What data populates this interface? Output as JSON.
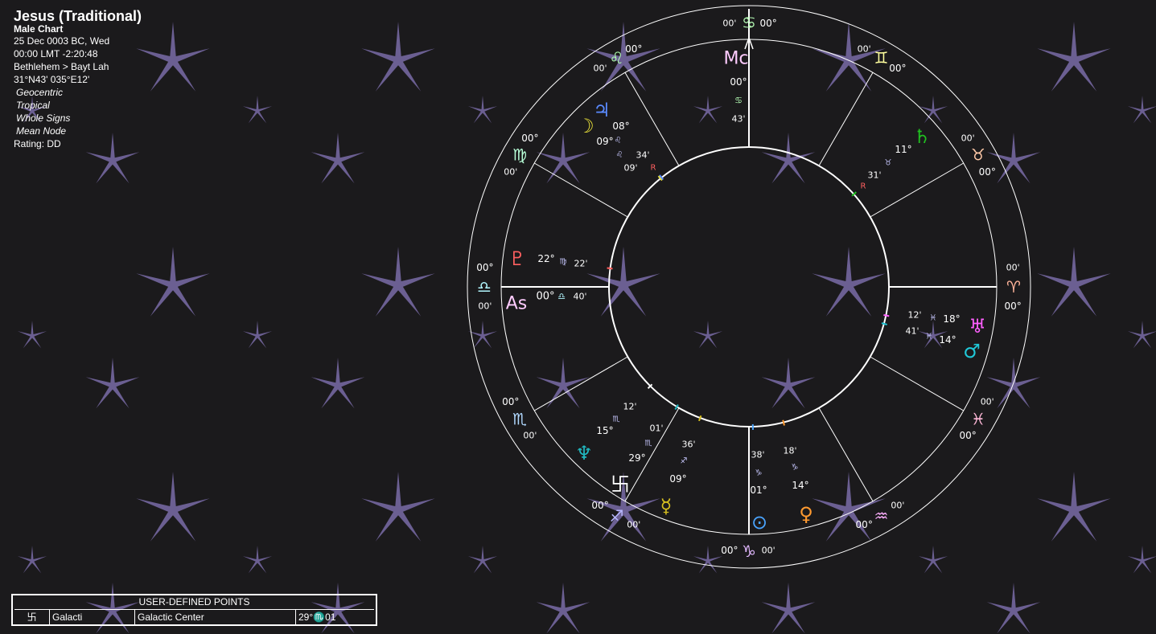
{
  "info": {
    "title": "Jesus (Traditional)",
    "subtitle": "Male Chart",
    "date": "25 Dec 0003 BC, Wed",
    "time": "00:00  LMT -2:20:48",
    "place": "Bethlehem > Bayt Lah",
    "coords": "31°N43' 035°E12'",
    "zodiac_type": "Geocentric",
    "zodiac": "Tropical",
    "houses": "Whole Signs",
    "node": "Mean Node",
    "rating": "Rating: DD"
  },
  "udp": {
    "header": "USER-DEFINED POINTS",
    "rows": [
      {
        "glyph": "卐",
        "name": "Galacti",
        "full": "Galactic Center",
        "pos": "29°♏01"
      }
    ]
  },
  "colors": {
    "background": "#1b1a1c",
    "star": "#6b5f92",
    "wheel": "#ffffff"
  },
  "signs": [
    {
      "name": "Aries",
      "glyph": "♈",
      "color": "#ffb49a",
      "deg": "00°",
      "min": "00'"
    },
    {
      "name": "Taurus",
      "glyph": "♉",
      "color": "#ffc9a8",
      "deg": "00°",
      "min": "00'"
    },
    {
      "name": "Gemini",
      "glyph": "♊",
      "color": "#ffff9e",
      "deg": "00°",
      "min": "00'"
    },
    {
      "name": "Cancer",
      "glyph": "♋",
      "color": "#b6ffb6",
      "deg": "00°",
      "min": "00'"
    },
    {
      "name": "Leo",
      "glyph": "♌",
      "color": "#b0ffb0",
      "deg": "00°",
      "min": "00'"
    },
    {
      "name": "Virgo",
      "glyph": "♍",
      "color": "#b8ffd8",
      "deg": "00°",
      "min": "00'"
    },
    {
      "name": "Libra",
      "glyph": "♎",
      "color": "#b2f7ff",
      "deg": "00°",
      "min": "00'"
    },
    {
      "name": "Scorpio",
      "glyph": "♏",
      "color": "#b0d8ff",
      "deg": "00°",
      "min": "00'"
    },
    {
      "name": "Sagittarius",
      "glyph": "♐",
      "color": "#b8b8ff",
      "deg": "00°",
      "min": "00'"
    },
    {
      "name": "Capricorn",
      "glyph": "♑",
      "color": "#e2b8ff",
      "deg": "00°",
      "min": "00'"
    },
    {
      "name": "Aquarius",
      "glyph": "♒",
      "color": "#ffb0ff",
      "deg": "00°",
      "min": "00'"
    },
    {
      "name": "Pisces",
      "glyph": "♓",
      "color": "#ffb8d8",
      "deg": "00°",
      "min": "00'"
    }
  ],
  "angles": {
    "asc": {
      "label": "As",
      "deg": "00°",
      "sign": "♎",
      "min": "40'",
      "color": "#ffccff"
    },
    "mc": {
      "label": "Mc",
      "deg": "00°",
      "sign": "♋",
      "min": "43'",
      "color": "#ffccff"
    }
  },
  "planets": [
    {
      "name": "Sun",
      "glyph": "⊙",
      "color": "#4aa4ff",
      "deg": "01°",
      "sign": "♑",
      "min": "38'",
      "retro": ""
    },
    {
      "name": "Moon",
      "glyph": "☽",
      "color": "#e8e03a",
      "deg": "09°",
      "sign": "♌",
      "min": "09'",
      "retro": ""
    },
    {
      "name": "Mercury",
      "glyph": "☿",
      "color": "#d8c020",
      "deg": "09°",
      "sign": "♐",
      "min": "36'",
      "retro": ""
    },
    {
      "name": "Venus",
      "glyph": "♀",
      "color": "#ff9a30",
      "deg": "14°",
      "sign": "♑",
      "min": "18'",
      "retro": ""
    },
    {
      "name": "Mars",
      "glyph": "♂",
      "color": "#20c8d8",
      "deg": "14°",
      "sign": "♓",
      "min": "41'",
      "retro": ""
    },
    {
      "name": "Jupiter",
      "glyph": "♃",
      "color": "#5a8aff",
      "deg": "08°",
      "sign": "♌",
      "min": "34'",
      "retro": "R"
    },
    {
      "name": "Saturn",
      "glyph": "♄",
      "color": "#20c020",
      "deg": "11°",
      "sign": "♉",
      "min": "31'",
      "retro": "R"
    },
    {
      "name": "Uranus",
      "glyph": "♅",
      "color": "#ff60ff",
      "deg": "18°",
      "sign": "♓",
      "min": "12'",
      "retro": ""
    },
    {
      "name": "Neptune",
      "glyph": "♆",
      "color": "#20b8c0",
      "deg": "29°",
      "sign": "♏",
      "min": "01'",
      "retro": ""
    },
    {
      "name": "Pluto",
      "glyph": "♇",
      "color": "#ff6060",
      "deg": "22°",
      "sign": "♍",
      "min": "22'",
      "retro": ""
    },
    {
      "name": "Galactic Center",
      "glyph": "卐",
      "color": "#ffffff",
      "deg": "15°",
      "sign": "♏",
      "min": "12'",
      "retro": ""
    }
  ]
}
